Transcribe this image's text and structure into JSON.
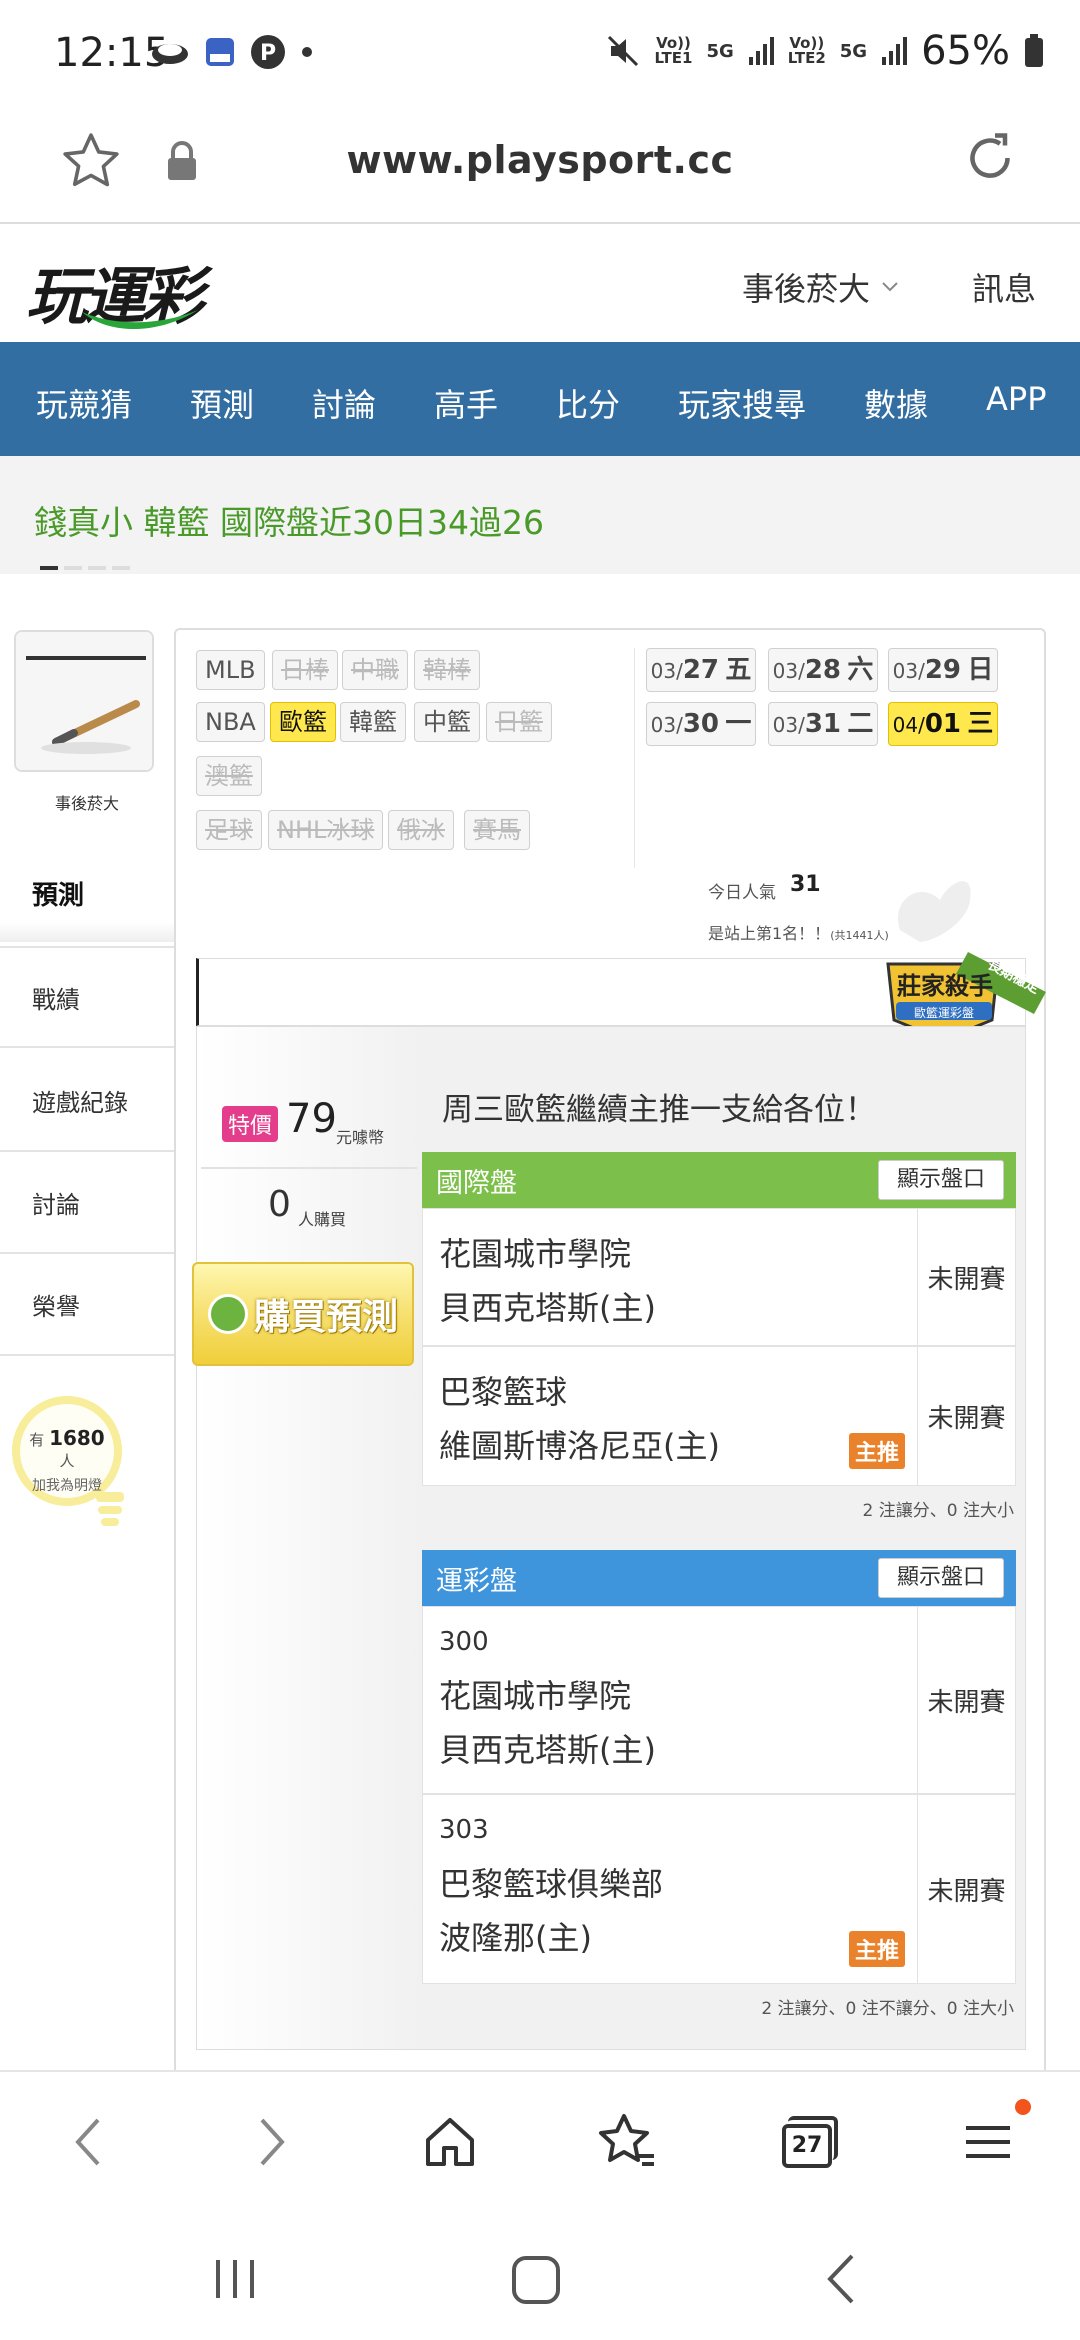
{
  "status_bar": {
    "time": "12:15",
    "battery": "65%",
    "net1": "Vo))\nLTE1",
    "net2": "Vo))\nLTE2",
    "five_g": "5G"
  },
  "url_bar": {
    "url": "www.playsport.cc"
  },
  "site": {
    "logo": "玩運彩",
    "user_menu": "事後菸大",
    "messages": "訊息"
  },
  "main_nav": [
    "玩競猜",
    "預測",
    "討論",
    "高手",
    "比分",
    "玩家搜尋",
    "數據",
    "APP"
  ],
  "ticker": {
    "text": "錢真小 韓籃 國際盤近30日34過26"
  },
  "sidebar": {
    "username": "事後菸大",
    "items": [
      "預測",
      "戰績",
      "遊戲紀錄",
      "討論",
      "榮譽"
    ],
    "fans_prefix": "有",
    "fans_count": "1680",
    "fans_suffix": "人",
    "fans_note": "加我為明燈"
  },
  "leagues": [
    {
      "label": "MLB",
      "state": "on"
    },
    {
      "label": "日棒",
      "state": "off"
    },
    {
      "label": "中職",
      "state": "off"
    },
    {
      "label": "韓棒",
      "state": "off"
    },
    {
      "label": "NBA",
      "state": "on"
    },
    {
      "label": "歐籃",
      "state": "selected"
    },
    {
      "label": "韓籃",
      "state": "on"
    },
    {
      "label": "中籃",
      "state": "on"
    },
    {
      "label": "日籃",
      "state": "off"
    },
    {
      "label": "澳籃",
      "state": "off"
    },
    {
      "label": "足球",
      "state": "off"
    },
    {
      "label": "NHL冰球",
      "state": "off"
    },
    {
      "label": "俄冰",
      "state": "off"
    },
    {
      "label": "賽馬",
      "state": "off"
    }
  ],
  "dates": [
    {
      "prefix": "03/",
      "day": "27",
      "weekday": "五",
      "selected": false
    },
    {
      "prefix": "03/",
      "day": "28",
      "weekday": "六",
      "selected": false
    },
    {
      "prefix": "03/",
      "day": "29",
      "weekday": "日",
      "selected": false
    },
    {
      "prefix": "03/",
      "day": "30",
      "weekday": "一",
      "selected": false
    },
    {
      "prefix": "03/",
      "day": "31",
      "weekday": "二",
      "selected": false
    },
    {
      "prefix": "04/",
      "day": "01",
      "weekday": "三",
      "selected": true
    }
  ],
  "popularity": {
    "label": "今日人氣",
    "value": "31",
    "rank_text": "是站上第1名！！",
    "rank_total": "(共1441人)"
  },
  "badge": {
    "title": "莊家殺手",
    "sub": "歐籃運彩盤",
    "ribbon": "長期穩定"
  },
  "prediction": {
    "headline": "周三歐籃繼續主推一支給各位！",
    "price_tag": "特價",
    "price": "79",
    "price_unit": "元噱幣",
    "buyers": "0",
    "buyers_unit": "人購買",
    "buy_button": "購買預測"
  },
  "intl_table": {
    "title": "國際盤",
    "show_label": "顯示盤口",
    "color": "#7cc04b",
    "rows": [
      {
        "lines": [
          "花園城市學院",
          "貝西克塔斯(主)"
        ],
        "status": "未開賽",
        "hot": ""
      },
      {
        "lines": [
          "巴黎籃球",
          "維圖斯博洛尼亞(主)"
        ],
        "status": "未開賽",
        "hot": "主推"
      }
    ],
    "summary": "2 注讓分、0 注大小"
  },
  "lottery_table": {
    "title": "運彩盤",
    "show_label": "顯示盤口",
    "color": "#3f95dc",
    "rows": [
      {
        "lines": [
          "300",
          "花園城市學院",
          "貝西克塔斯(主)"
        ],
        "status": "未開賽",
        "hot": ""
      },
      {
        "lines": [
          "303",
          "巴黎籃球俱樂部",
          "波隆那(主)"
        ],
        "status": "未開賽",
        "hot": "主推"
      }
    ],
    "summary": "2 注讓分、0 注不讓分、0 注大小"
  },
  "browser_bar": {
    "tabs_count": "27"
  }
}
